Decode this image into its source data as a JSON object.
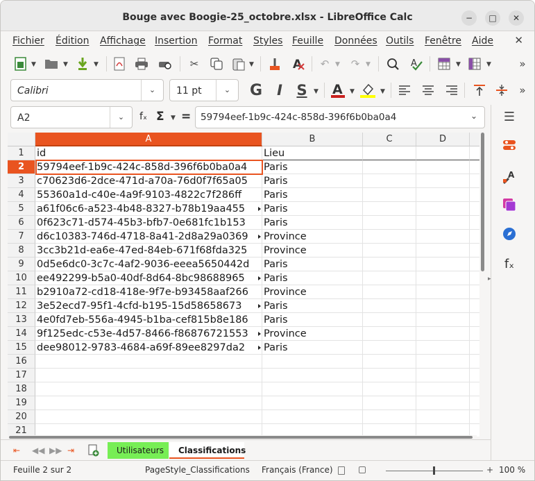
{
  "window": {
    "title": "Bouge avec Boogie-25_octobre.xlsx - LibreOffice Calc",
    "buttons": {
      "minimize": "−",
      "maximize": "□",
      "close": "✕"
    }
  },
  "menu": [
    "Fichier",
    "Édition",
    "Affichage",
    "Insertion",
    "Format",
    "Styles",
    "Feuille",
    "Données",
    "Outils",
    "Fenêtre",
    "Aide"
  ],
  "menu_close_glyph": "✕",
  "toolbar": {
    "more_glyph": "»",
    "font_name": "Calibri",
    "font_size": "11 pt"
  },
  "formula_bar": {
    "name_box": "A2",
    "fx_label": "fₓ",
    "sigma_label": "Σ",
    "equals_label": "=",
    "content": "59794eef-1b9c-424c-858d-396f6b0ba0a4"
  },
  "columns": [
    "A",
    "B",
    "C",
    "D"
  ],
  "active_column": "A",
  "active_row": "2",
  "rows": [
    {
      "n": "1",
      "a": "id",
      "b": "Lieu",
      "overflow": false
    },
    {
      "n": "2",
      "a": "59794eef-1b9c-424c-858d-396f6b0ba0a4",
      "b": "Paris",
      "overflow": false
    },
    {
      "n": "3",
      "a": "c70623d6-2dce-471d-a70a-76d0f7f65a05",
      "b": "Paris",
      "overflow": false
    },
    {
      "n": "4",
      "a": "55360a1d-c40e-4a9f-9103-4822c7f286ff",
      "b": "Paris",
      "overflow": false
    },
    {
      "n": "5",
      "a": "a61f06c6-a523-4b48-8327-b78b19aa455",
      "b": "Paris",
      "overflow": true
    },
    {
      "n": "6",
      "a": "0f623c71-d574-45b3-bfb7-0e681fc1b153",
      "b": "Paris",
      "overflow": false
    },
    {
      "n": "7",
      "a": "d6c10383-746d-4718-8a41-2d8a29a0369",
      "b": "Province",
      "overflow": true
    },
    {
      "n": "8",
      "a": "3cc3b21d-ea6e-47ed-84eb-671f68fda325",
      "b": "Province",
      "overflow": false
    },
    {
      "n": "9",
      "a": "0d5e6dc0-3c7c-4af2-9036-eeea5650442d",
      "b": "Paris",
      "overflow": false
    },
    {
      "n": "10",
      "a": "ee492299-b5a0-40df-8d64-8bc98688965",
      "b": "Paris",
      "overflow": true
    },
    {
      "n": "11",
      "a": "b2910a72-cd18-418e-9f7e-b93458aaf266",
      "b": "Province",
      "overflow": false
    },
    {
      "n": "12",
      "a": "3e52ecd7-95f1-4cfd-b195-15d58658673",
      "b": "Paris",
      "overflow": true
    },
    {
      "n": "13",
      "a": "4e0fd7eb-556a-4945-b1ba-cef815b8e186",
      "b": "Paris",
      "overflow": false
    },
    {
      "n": "14",
      "a": "9f125edc-c53e-4d57-8466-f86876721553",
      "b": "Province",
      "overflow": true
    },
    {
      "n": "15",
      "a": "dee98012-9783-4684-a69f-89ee8297da2",
      "b": "Paris",
      "overflow": true
    },
    {
      "n": "16",
      "a": "",
      "b": "",
      "overflow": false
    },
    {
      "n": "17",
      "a": "",
      "b": "",
      "overflow": false
    },
    {
      "n": "18",
      "a": "",
      "b": "",
      "overflow": false
    },
    {
      "n": "19",
      "a": "",
      "b": "",
      "overflow": false
    },
    {
      "n": "20",
      "a": "",
      "b": "",
      "overflow": false
    },
    {
      "n": "21",
      "a": "",
      "b": "",
      "overflow": false
    }
  ],
  "sheets": [
    {
      "name": "Utilisateurs",
      "active": false,
      "color": "#77ee55"
    },
    {
      "name": "Classifications",
      "active": true,
      "color": "#ffffff"
    }
  ],
  "status": {
    "sheet": "Feuille 2 sur 2",
    "page_style": "PageStyle_Classifications",
    "language": "Français (France)",
    "zoom": "100 %"
  },
  "colors": {
    "accent": "#e95420",
    "active_tab": "#77ee55"
  }
}
